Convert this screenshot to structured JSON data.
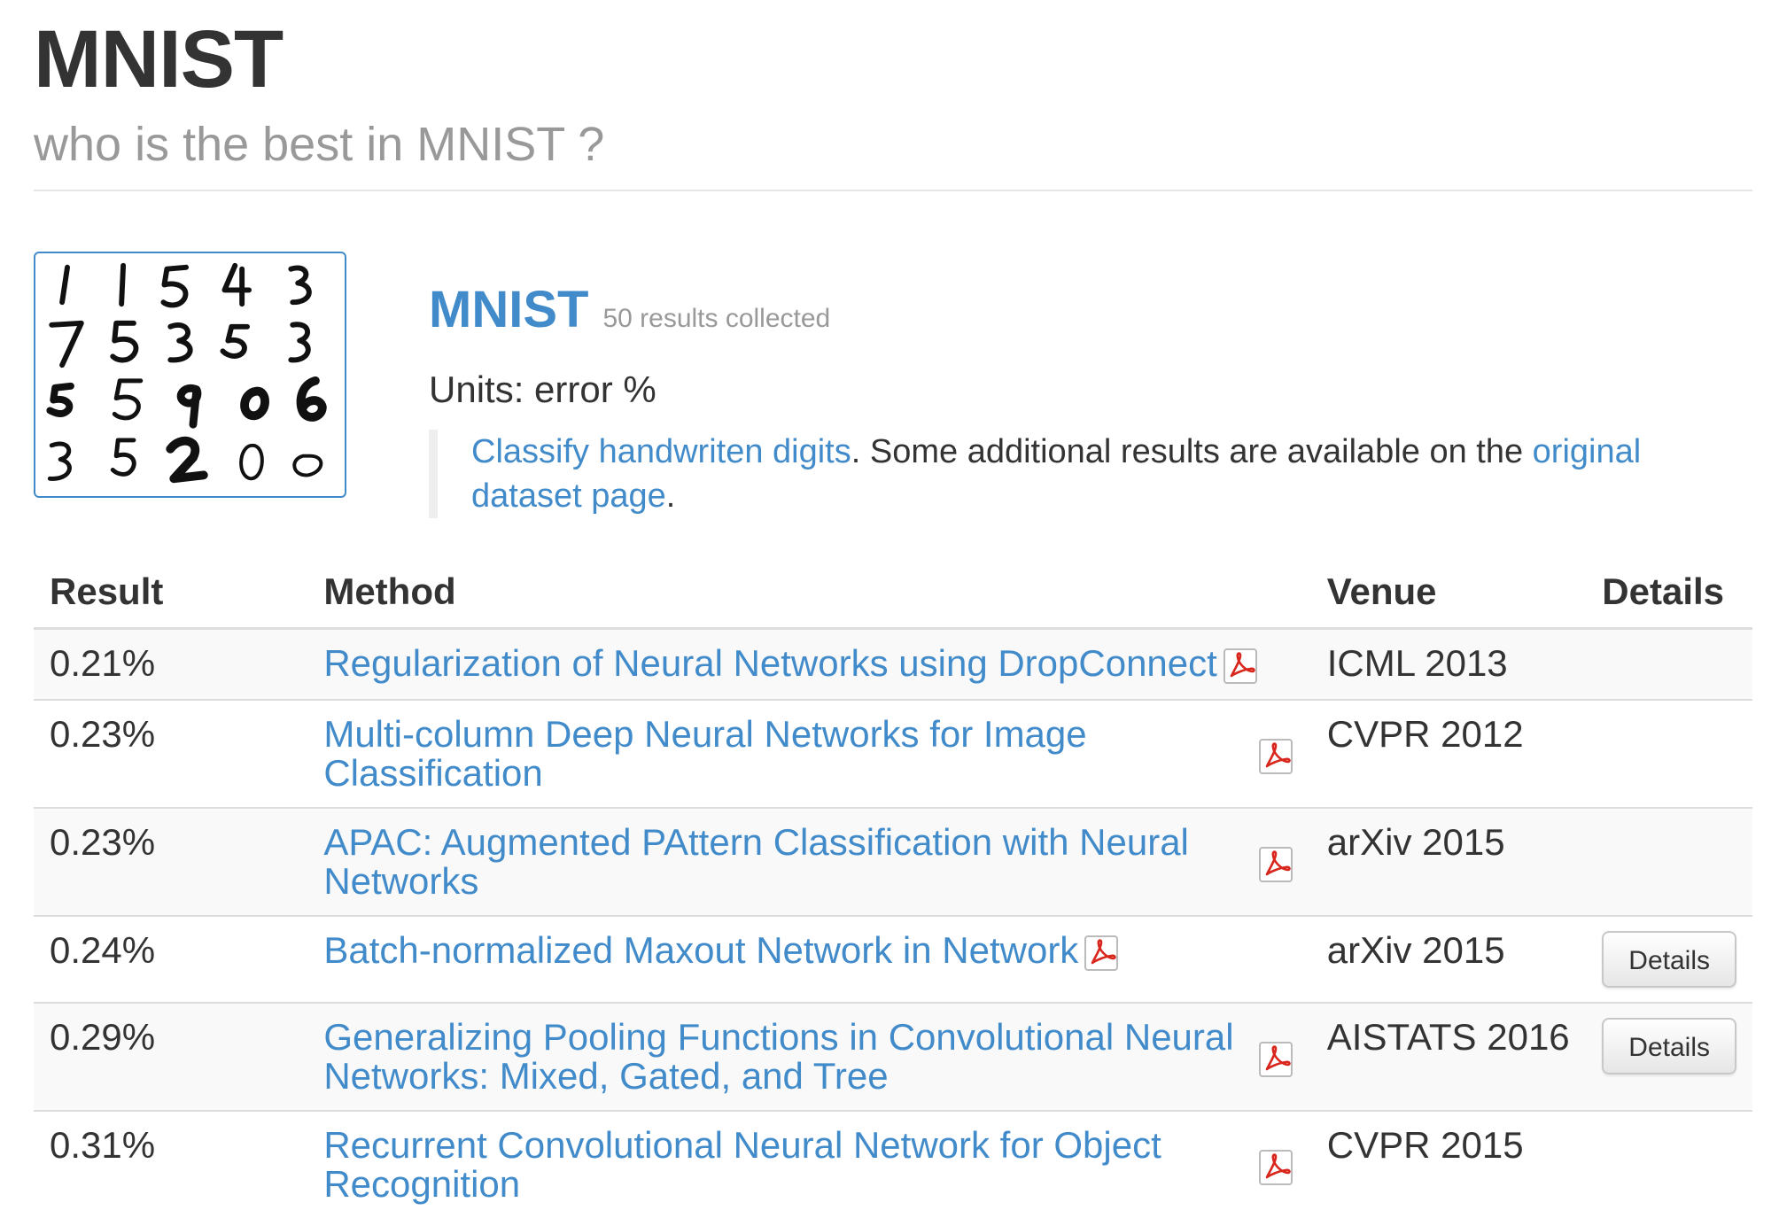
{
  "page": {
    "title": "MNIST",
    "subtitle": "who is the best in MNIST ?"
  },
  "dataset": {
    "name": "MNIST",
    "results_collected": "50 results collected",
    "units": "Units: error %",
    "description": {
      "link1": "Classify handwriten digits",
      "middle": ". Some additional results are available on the ",
      "link2": "original dataset page",
      "end": "."
    }
  },
  "table": {
    "headers": [
      "Result",
      "Method",
      "Venue",
      "Details"
    ],
    "rows": [
      {
        "result": "0.21%",
        "method": "Regularization of Neural Networks using DropConnect",
        "venue": "ICML 2013",
        "details": ""
      },
      {
        "result": "0.23%",
        "method": "Multi-column Deep Neural Networks for Image Classification",
        "venue": "CVPR 2012",
        "details": ""
      },
      {
        "result": "0.23%",
        "method": "APAC: Augmented PAttern Classification with Neural Networks",
        "venue": "arXiv 2015",
        "details": ""
      },
      {
        "result": "0.24%",
        "method": "Batch-normalized Maxout Network in Network",
        "venue": "arXiv 2015",
        "details": "Details"
      },
      {
        "result": "0.29%",
        "method": "Generalizing Pooling Functions in Convolutional Neural Networks: Mixed, Gated, and Tree",
        "venue": "AISTATS 2016",
        "details": "Details"
      },
      {
        "result": "0.31%",
        "method": "Recurrent Convolutional Neural Network for Object Recognition",
        "venue": "CVPR 2015",
        "details": ""
      }
    ]
  },
  "icons": {
    "pdf": "pdf-icon"
  },
  "colors": {
    "link": "#428bca",
    "muted": "#999999",
    "text": "#333333",
    "pdf_red": "#d9261c"
  }
}
